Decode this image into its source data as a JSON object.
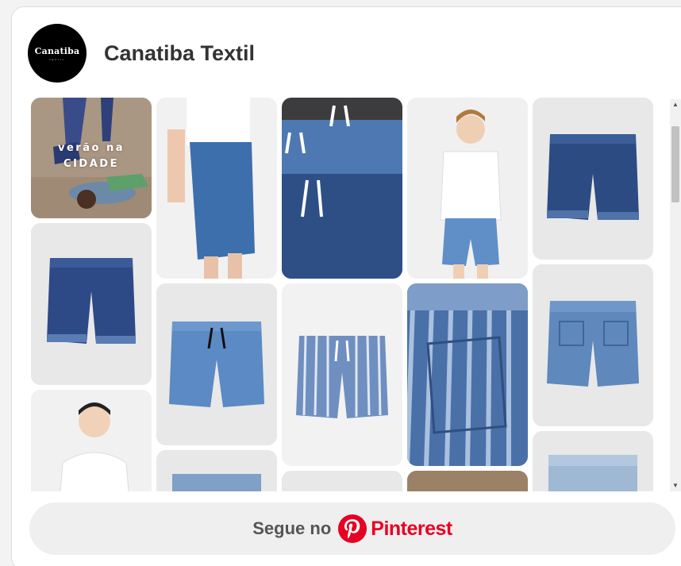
{
  "board": {
    "name": "Canatiba Textil",
    "avatar_text": "Canatiba",
    "avatar_subtext": "TEXTIL"
  },
  "pins": {
    "promo_line1": "verão na",
    "promo_line2": "CIDADE"
  },
  "follow": {
    "label": "Segue no",
    "brand": "Pinterest",
    "brand_color": "#e60023"
  },
  "scrollbar": {
    "up_arrow": "▲",
    "down_arrow": "▼"
  }
}
